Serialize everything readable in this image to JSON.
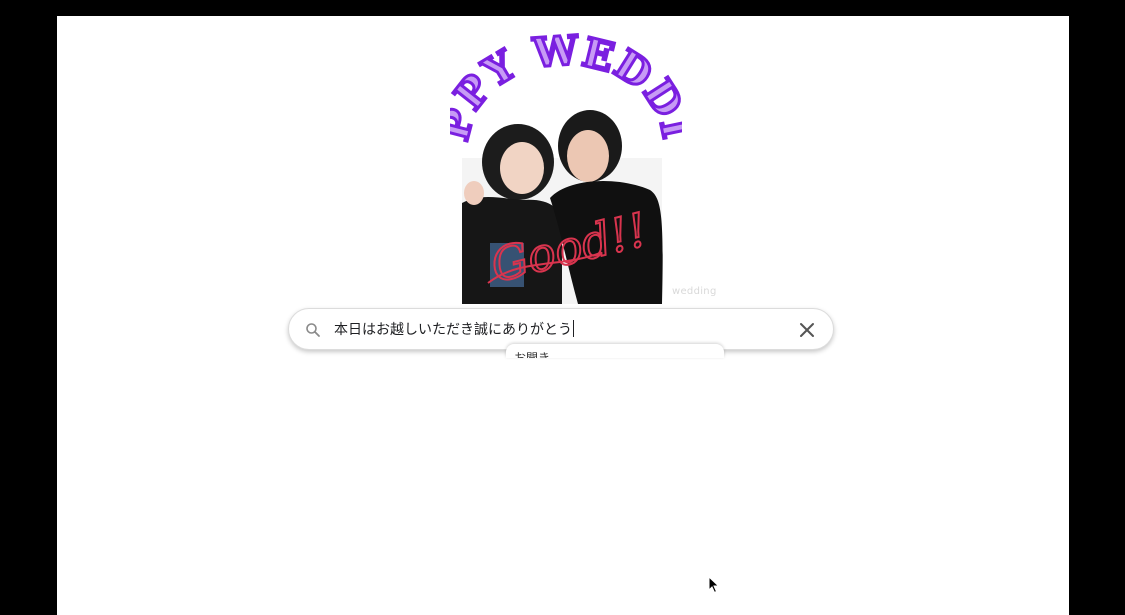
{
  "hero": {
    "arch_text": "HAPPY WEDDING",
    "signature": "Good!!",
    "watermark": "wedding"
  },
  "search": {
    "query": "本日はお越しいただき誠にありがとう",
    "icon": "search-icon",
    "clear_icon": "close-icon"
  },
  "suggestion": {
    "label": "お開き"
  },
  "colors": {
    "arch_purple": "#7a1fe0",
    "arch_light": "#c79bf5",
    "signature_red": "#d9344e",
    "frame": "#000000"
  }
}
